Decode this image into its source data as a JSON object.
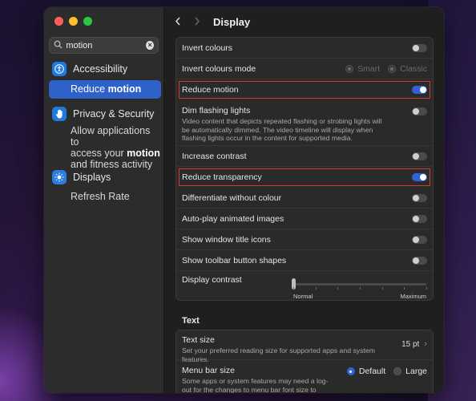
{
  "window": {
    "title": "Display"
  },
  "search": {
    "value": "motion"
  },
  "sidebar": {
    "accessibility": {
      "label": "Accessibility",
      "sub": {
        "pre": "Reduce ",
        "bold": "motion"
      }
    },
    "privacy": {
      "label": "Privacy & Security",
      "sub_line1": "Allow applications to",
      "sub_line2_pre": "access your ",
      "sub_line2_bold": "motion",
      "sub_line3": "and fitness activity"
    },
    "displays": {
      "label": "Displays",
      "sub": "Refresh Rate"
    }
  },
  "settings": {
    "invert_colours": "Invert colours",
    "invert_mode": "Invert colours mode",
    "invert_mode_smart": "Smart",
    "invert_mode_classic": "Classic",
    "reduce_motion": "Reduce motion",
    "dim_flashing": "Dim flashing lights",
    "dim_flashing_desc": "Video content that depicts repeated flashing or strobing lights will be automatically dimmed. The video timeline will display when flashing lights occur in the content for supported media.",
    "increase_contrast": "Increase contrast",
    "reduce_transparency": "Reduce transparency",
    "differentiate": "Differentiate without colour",
    "autoplay": "Auto-play animated images",
    "window_title_icons": "Show window title icons",
    "toolbar_shapes": "Show toolbar button shapes",
    "display_contrast": "Display contrast",
    "contrast_min": "Normal",
    "contrast_max": "Maximum"
  },
  "toggles": {
    "invert_colours": false,
    "reduce_motion": true,
    "dim_flashing": false,
    "increase_contrast": false,
    "reduce_transparency": true,
    "differentiate": false,
    "autoplay": false,
    "window_title_icons": false,
    "toolbar_shapes": false
  },
  "contrast_level": 0,
  "text_section": {
    "title": "Text",
    "text_size": "Text size",
    "text_size_desc": "Set your preferred reading size for supported apps and system features.",
    "text_size_value": "15 pt",
    "menu_bar_size": "Menu bar size",
    "menu_bar_desc": "Some apps or system features may need a log-out for the changes to menu bar font size to take effect.",
    "opt_default": "Default",
    "opt_large": "Large"
  },
  "colors": {
    "accent": "#2f64d6",
    "highlight": "#d2392f"
  }
}
